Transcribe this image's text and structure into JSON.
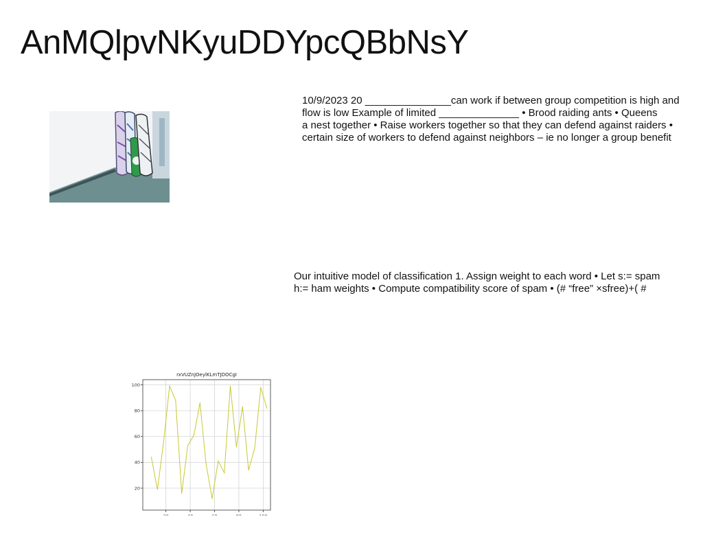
{
  "page": {
    "title": "AnMQlpvNKyuDDYpcQBbNsY"
  },
  "text_block_1": {
    "lines": [
      "10/9/2023 20 _______________can work if between group competition is high and",
      "flow is low Example of limited ______________ • Brood raiding ants • Queens",
      "a nest together • Raise workers together so that they can defend against raiders •",
      "certain size of workers to defend against neighbors – ie no longer a group benefit"
    ]
  },
  "text_block_2": {
    "lines": [
      "Our intuitive model of classification 1. Assign weight to each word • Let s:= spam",
      "h:= ham weights • Compute compatibility score of spam • (# “free” ×sfree)+( #"
    ]
  },
  "chart_data": {
    "type": "line",
    "title": "rxVUZnJOeylKLmTJDOCgI",
    "xlabel": "",
    "ylabel": "",
    "x": [
      8,
      13,
      18,
      23,
      28,
      33,
      38,
      43,
      48,
      53,
      58,
      63,
      68,
      73,
      78,
      83,
      88,
      93,
      98,
      103
    ],
    "series": [
      {
        "values": [
          44,
          19,
          55,
          99,
          88,
          16,
          53,
          61,
          86,
          39,
          12,
          41,
          32,
          99,
          52,
          83,
          34,
          51,
          98,
          82
        ],
        "color": "#c8c832"
      }
    ],
    "xlim": [
      1,
      106
    ],
    "ylim": [
      3,
      104
    ],
    "xticks": [
      20,
      40,
      60,
      80,
      100
    ],
    "yticks": [
      20,
      40,
      60,
      80,
      100
    ],
    "grid": true
  }
}
